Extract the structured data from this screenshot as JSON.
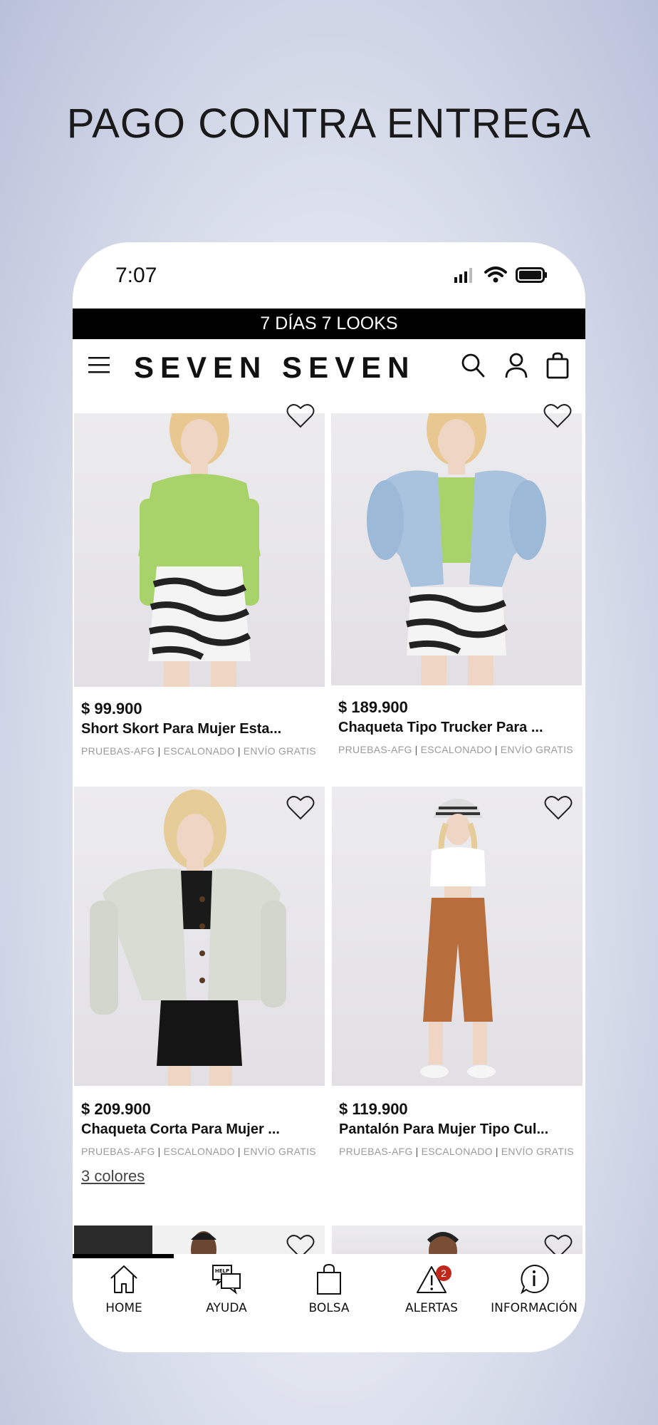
{
  "headline": "PAGO CONTRA ENTREGA",
  "status_bar": {
    "time": "7:07",
    "icons": [
      "signal-icon",
      "wifi-icon",
      "battery-icon"
    ]
  },
  "promo_banner": "7 DÍAS 7 LOOKS",
  "header": {
    "logo": "SEVEN SEVEN",
    "icons": [
      "menu-icon",
      "search-icon",
      "account-icon",
      "bag-icon"
    ]
  },
  "products": [
    {
      "price": "$ 99.900",
      "title": "Short Skort Para Mujer Esta...",
      "tags": [
        "PRUEBAS-AFG",
        "ESCALONADO",
        "ENVÍO GRATIS"
      ]
    },
    {
      "price": "$ 189.900",
      "title": "Chaqueta Tipo Trucker Para ...",
      "tags": [
        "PRUEBAS-AFG",
        "ESCALONADO",
        "ENVÍO GRATIS"
      ]
    },
    {
      "price": "$ 209.900",
      "title": "Chaqueta Corta Para Mujer ...",
      "tags": [
        "PRUEBAS-AFG",
        "ESCALONADO",
        "ENVÍO GRATIS"
      ],
      "colors": "3 colores"
    },
    {
      "price": "$ 119.900",
      "title": "Pantalón Para Mujer Tipo Cul...",
      "tags": [
        "PRUEBAS-AFG",
        "ESCALONADO",
        "ENVÍO GRATIS"
      ]
    }
  ],
  "tabbar": {
    "items": [
      {
        "label": "HOME",
        "icon": "home-icon"
      },
      {
        "label": "AYUDA",
        "icon": "help-icon",
        "icon_text": "HELP"
      },
      {
        "label": "BOLSA",
        "icon": "bag-icon"
      },
      {
        "label": "ALERTAS",
        "icon": "alert-icon",
        "badge": "2"
      },
      {
        "label": "INFORMACIÓN",
        "icon": "info-icon"
      }
    ]
  },
  "colors": {
    "accent": "#000000",
    "badge": "#c0281c",
    "tag_text": "#9a9a9a"
  }
}
